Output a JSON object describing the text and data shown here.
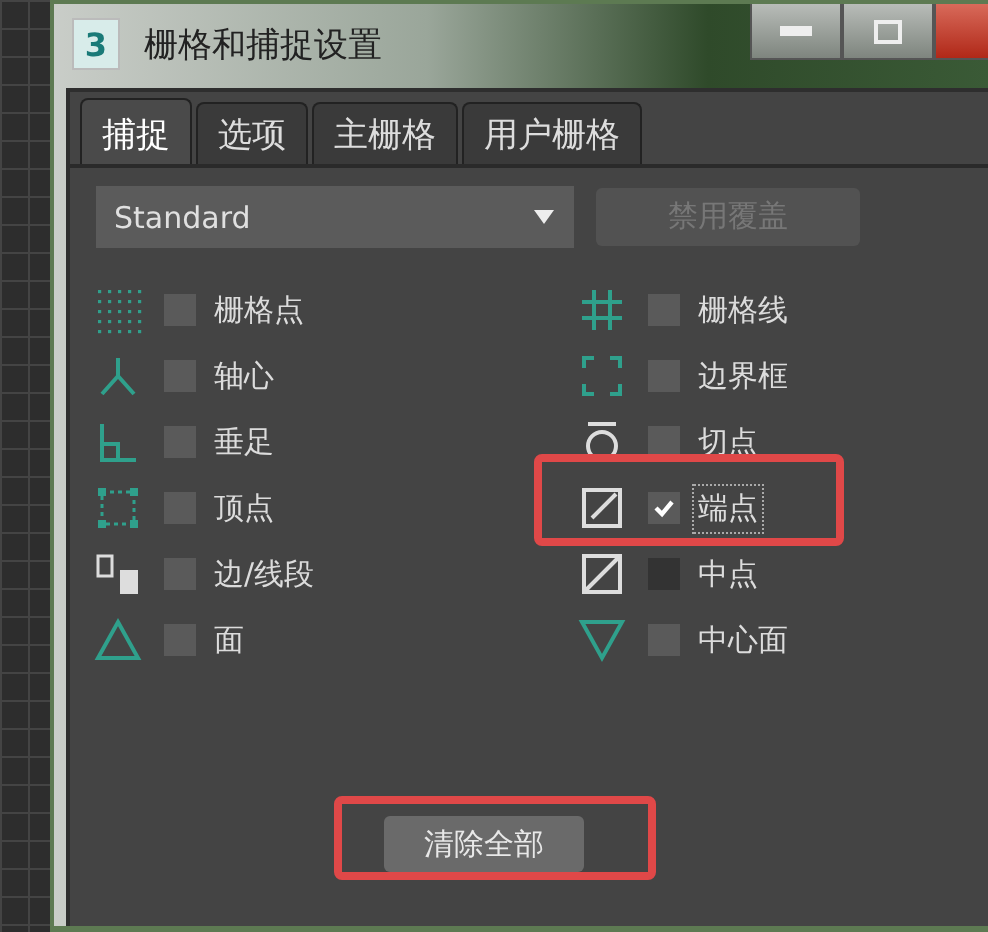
{
  "window": {
    "app_icon": "3",
    "title": "栅格和捕捉设置"
  },
  "tabs": [
    {
      "label": "捕捉",
      "selected": true
    },
    {
      "label": "选项",
      "selected": false
    },
    {
      "label": "主栅格",
      "selected": false
    },
    {
      "label": "用户栅格",
      "selected": false
    }
  ],
  "preset_dropdown": {
    "value": "Standard"
  },
  "override_button": {
    "label": "禁用覆盖",
    "disabled": true
  },
  "snaps": [
    {
      "kind": "gridpoints",
      "label": "栅格点",
      "checked": false,
      "disabled": false,
      "highlighted": false
    },
    {
      "kind": "gridlines",
      "label": "栅格线",
      "checked": false,
      "disabled": false,
      "highlighted": false
    },
    {
      "kind": "pivot",
      "label": "轴心",
      "checked": false,
      "disabled": false,
      "highlighted": false
    },
    {
      "kind": "bbox",
      "label": "边界框",
      "checked": false,
      "disabled": false,
      "highlighted": false
    },
    {
      "kind": "perpendicular",
      "label": "垂足",
      "checked": false,
      "disabled": false,
      "highlighted": false
    },
    {
      "kind": "tangent",
      "label": "切点",
      "checked": false,
      "disabled": false,
      "highlighted": false
    },
    {
      "kind": "vertex",
      "label": "顶点",
      "checked": false,
      "disabled": false,
      "highlighted": false
    },
    {
      "kind": "endpoint",
      "label": "端点",
      "checked": true,
      "disabled": false,
      "highlighted": true
    },
    {
      "kind": "edge",
      "label": "边/线段",
      "checked": false,
      "disabled": false,
      "highlighted": false
    },
    {
      "kind": "midpoint",
      "label": "中点",
      "checked": false,
      "disabled": true,
      "highlighted": false
    },
    {
      "kind": "face",
      "label": "面",
      "checked": false,
      "disabled": false,
      "highlighted": false
    },
    {
      "kind": "centerface",
      "label": "中心面",
      "checked": false,
      "disabled": false,
      "highlighted": false
    }
  ],
  "clear_button": {
    "label": "清除全部",
    "highlighted": true
  }
}
